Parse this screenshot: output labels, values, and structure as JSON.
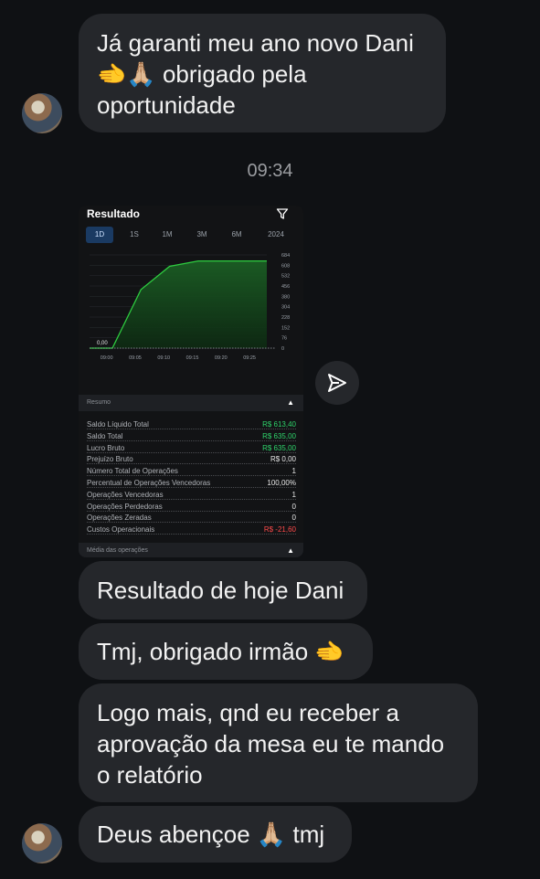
{
  "messages": {
    "m1": "Já garanti meu ano novo Dani\n🫲🙏🏼 obrigado pela\noportunidade",
    "timestamp": "09:34",
    "m2": "Resultado de hoje Dani",
    "m3": "Tmj, obrigado irmão 🫲",
    "m4": "Logo mais, qnd eu receber a\naprovação da mesa eu te mando\no relatório",
    "m5": "Deus abençoe 🙏🏼 tmj"
  },
  "card": {
    "title": "Resultado",
    "periods": [
      "1D",
      "1S",
      "1M",
      "3M",
      "6M",
      "2024"
    ],
    "active_period": "1D",
    "summary_label": "Resumo",
    "media_label": "Média das operações",
    "rows": [
      {
        "label": "Saldo Líquido Total",
        "value": "R$ 613,40",
        "color": "green"
      },
      {
        "label": "Saldo Total",
        "value": "R$ 635,00",
        "color": "green"
      },
      {
        "label": "Lucro Bruto",
        "value": "R$ 635,00",
        "color": "green"
      },
      {
        "label": "Prejuízo Bruto",
        "value": "R$ 0,00",
        "color": "white"
      },
      {
        "label": "Número Total de Operações",
        "value": "1",
        "color": "white"
      },
      {
        "label": "Percentual de Operações Vencedoras",
        "value": "100,00%",
        "color": "white"
      },
      {
        "label": "Operações Vencedoras",
        "value": "1",
        "color": "white"
      },
      {
        "label": "Operações Perdedoras",
        "value": "0",
        "color": "white"
      },
      {
        "label": "Operações Zeradas",
        "value": "0",
        "color": "white"
      },
      {
        "label": "Custos Operacionais",
        "value": "R$ -21,60",
        "color": "red"
      }
    ]
  },
  "chart_data": {
    "type": "area",
    "x": [
      "09:00",
      "09:05",
      "09:10",
      "09:15",
      "09:20",
      "09:25"
    ],
    "x_ticks": [
      "09:00",
      "09:05",
      "09:10",
      "09:15",
      "09:20",
      "09:25"
    ],
    "y_ticks": [
      "684",
      "608",
      "532",
      "456",
      "380",
      "304",
      "228",
      "152",
      "76",
      "0"
    ],
    "start_label": "0,00",
    "series": [
      {
        "values": [
          0,
          0,
          430,
          600,
          640,
          640,
          640,
          640
        ]
      }
    ],
    "x_points": [
      "08:57",
      "09:01",
      "09:06",
      "09:11",
      "09:16",
      "09:20",
      "09:25",
      "09:28"
    ],
    "ylim": [
      0,
      684
    ],
    "line_color": "#2ecc40",
    "fill_color": "#1b5e24"
  },
  "colors": {
    "background": "#0f1114",
    "bubble": "#25272b",
    "accent_green": "#2fd26a",
    "accent_red": "#ff4b4b"
  },
  "icons": {
    "filter": "filter-icon",
    "share": "send-icon",
    "caret": "chevron-up-icon"
  }
}
